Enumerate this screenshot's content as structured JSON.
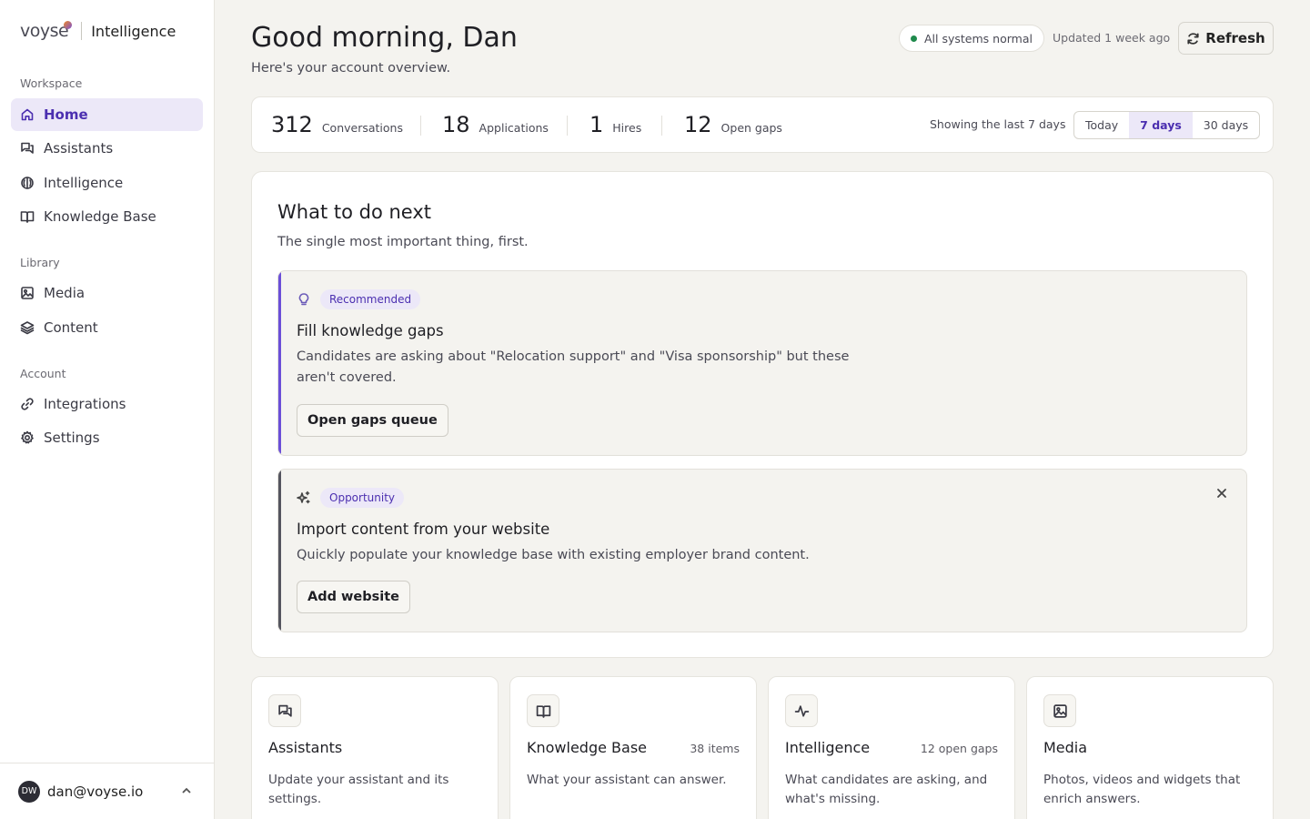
{
  "brand": {
    "logo_text": "voyse",
    "product": "Intelligence"
  },
  "sidebar": {
    "sections": [
      {
        "label": "Workspace"
      },
      {
        "label": "Library"
      },
      {
        "label": "Account"
      }
    ],
    "items": [
      {
        "label": "Home",
        "icon": "home-icon"
      },
      {
        "label": "Assistants",
        "icon": "chat-icon"
      },
      {
        "label": "Intelligence",
        "icon": "brain-icon"
      },
      {
        "label": "Knowledge Base",
        "icon": "book-icon"
      },
      {
        "label": "Media",
        "icon": "image-icon"
      },
      {
        "label": "Content",
        "icon": "layers-icon"
      },
      {
        "label": "Integrations",
        "icon": "link-icon"
      },
      {
        "label": "Settings",
        "icon": "gear-icon"
      }
    ],
    "user": {
      "initials": "DW",
      "email": "dan@voyse.io"
    }
  },
  "header": {
    "greeting": "Good morning, Dan",
    "subtitle": "Here's your account overview.",
    "status": "All systems normal",
    "updated": "Updated 1 week ago",
    "refresh_label": "Refresh"
  },
  "stats": {
    "items": [
      {
        "value": "312",
        "label": "Conversations"
      },
      {
        "value": "18",
        "label": "Applications"
      },
      {
        "value": "1",
        "label": "Hires"
      },
      {
        "value": "12",
        "label": "Open gaps"
      }
    ],
    "range_label": "Showing the last 7 days",
    "ranges": [
      "Today",
      "7 days",
      "30 days"
    ],
    "selected_range": "7 days"
  },
  "next": {
    "title": "What to do next",
    "subtitle": "The single most important thing, first.",
    "actions": [
      {
        "tag": "Recommended",
        "icon": "lightbulb-icon",
        "title": "Fill knowledge gaps",
        "description": "Candidates are asking about \"Relocation support\" and \"Visa sponsorship\" but these aren't covered.",
        "button": "Open gaps queue",
        "accent": "#6b4fd8"
      },
      {
        "tag": "Opportunity",
        "icon": "sparkles-icon",
        "title": "Import content from your website",
        "description": "Quickly populate your knowledge base with existing employer brand content.",
        "button": "Add website",
        "accent": "#55555f"
      }
    ]
  },
  "tiles": [
    {
      "title": "Assistants",
      "meta": "",
      "description": "Update your assistant and its settings.",
      "icon": "chat-icon"
    },
    {
      "title": "Knowledge Base",
      "meta": "38 items",
      "description": "What your assistant can answer.",
      "icon": "book-icon"
    },
    {
      "title": "Intelligence",
      "meta": "12 open gaps",
      "description": "What candidates are asking, and what's missing.",
      "icon": "activity-icon"
    },
    {
      "title": "Media",
      "meta": "",
      "description": "Photos, videos and widgets that enrich answers.",
      "icon": "image-icon"
    }
  ],
  "colors": {
    "accent": "#4b2fb0",
    "accent_bg": "#ece8f8",
    "status_ok": "#1f8a4c",
    "background": "#f4f3ef"
  }
}
